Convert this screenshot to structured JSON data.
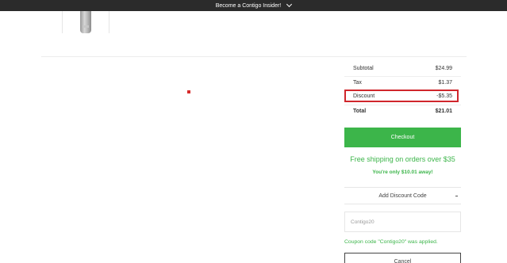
{
  "topbar": {
    "promo_text": "Become a Contigo Insider!",
    "icon": "chevron-down-icon"
  },
  "product": {
    "image": "bottle-image"
  },
  "summary": {
    "subtotal_label": "Subtotal",
    "subtotal_value": "$24.99",
    "tax_label": "Tax",
    "tax_value": "$1.37",
    "discount_label": "Discount",
    "discount_value": "-$5.35",
    "total_label": "Total",
    "total_value": "$21.01"
  },
  "checkout": {
    "label": "Checkout"
  },
  "shipping": {
    "message": "Free shipping on orders over $35",
    "remaining": "You're only $10.01 away!"
  },
  "discount_code": {
    "toggle_label": "Add Discount Code",
    "input_value": "Contigo20",
    "applied_message": "Coupon code \"Contigo20\" was applied.",
    "cancel_label": "Cancel"
  },
  "colors": {
    "accent_green": "#3cb54a",
    "highlight_red": "#d0262c",
    "topbar_bg": "#2b2b2b"
  }
}
